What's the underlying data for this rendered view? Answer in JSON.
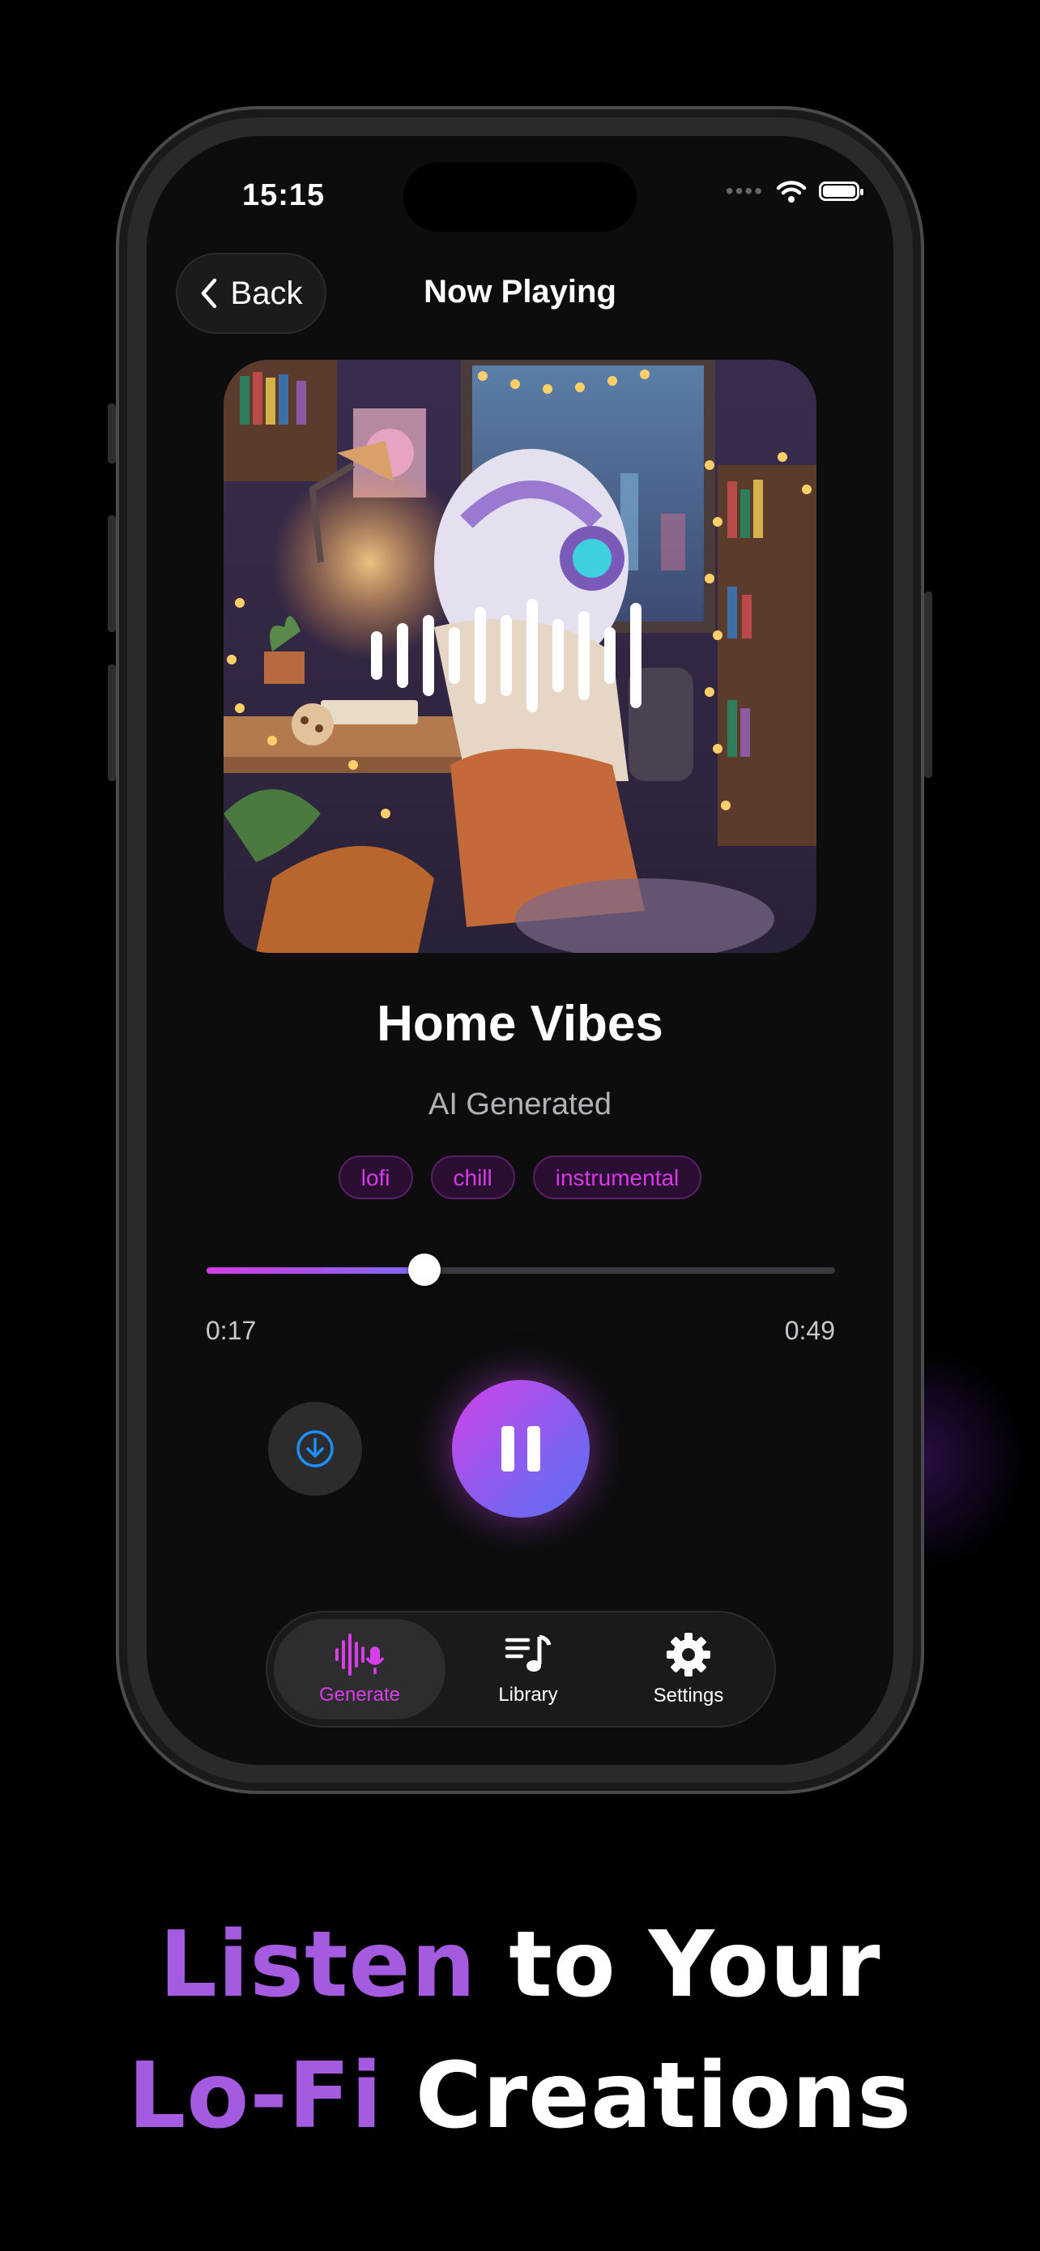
{
  "status_bar": {
    "time": "15:15",
    "signal_dots": "••••"
  },
  "nav": {
    "back_label": "Back",
    "title": "Now Playing"
  },
  "track": {
    "title": "Home Vibes",
    "subtitle": "AI Generated",
    "tags": [
      "lofi",
      "chill",
      "instrumental"
    ],
    "current_time": "0:17",
    "total_time": "0:49",
    "progress_fraction": 0.347
  },
  "controls": {
    "download_icon": "download-circle-icon",
    "pause_icon": "pause-icon"
  },
  "tabbar": {
    "items": [
      {
        "label": "Generate",
        "icon": "waveform-mic-icon",
        "active": true
      },
      {
        "label": "Library",
        "icon": "music-list-icon",
        "active": false
      },
      {
        "label": "Settings",
        "icon": "gear-icon",
        "active": false
      }
    ]
  },
  "headline": {
    "line1_accent": "Listen",
    "line1_rest": " to Your",
    "line2_accent": "Lo-Fi",
    "line2_rest": " Creations"
  },
  "colors": {
    "accent_pink": "#d83ee8",
    "accent_purple": "#a45be0",
    "play_gradient_start": "#d042e8",
    "play_gradient_end": "#5a6ff2",
    "background": "#000000"
  }
}
